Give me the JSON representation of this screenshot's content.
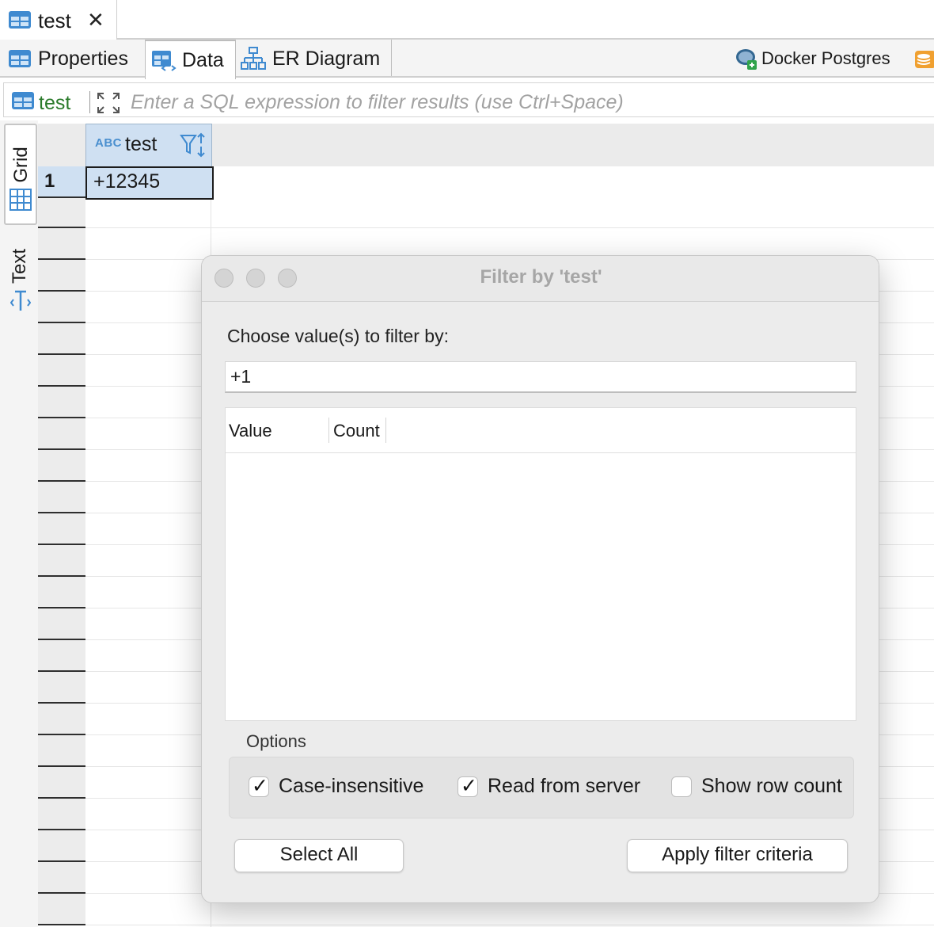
{
  "doc_tab": {
    "label": "test"
  },
  "editor_tabs": [
    {
      "label": "Properties"
    },
    {
      "label": "Data"
    },
    {
      "label": "ER Diagram"
    }
  ],
  "connection": {
    "label": "Docker Postgres"
  },
  "filter_bar": {
    "table": "test",
    "placeholder": "Enter a SQL expression to filter results (use Ctrl+Space)"
  },
  "side_panel": {
    "grid_label": "Grid",
    "text_label": "Text"
  },
  "grid": {
    "type_badge": "ABC",
    "column": "test",
    "rows": [
      {
        "num": "1",
        "value": "+12345"
      }
    ]
  },
  "dialog": {
    "title": "Filter by 'test'",
    "choose_label": "Choose value(s) to filter by:",
    "search_value": "+1",
    "columns": [
      "Value",
      "Count"
    ],
    "options_label": "Options",
    "options": [
      {
        "label": "Case-insensitive",
        "checked": true
      },
      {
        "label": "Read from server",
        "checked": true
      },
      {
        "label": "Show row count",
        "checked": false
      }
    ],
    "select_all_label": "Select All",
    "apply_label": "Apply filter criteria"
  },
  "colors": {
    "selection": "#cfe0f2",
    "accent": "#4a8fcf",
    "table_green": "#2a7a2a"
  }
}
